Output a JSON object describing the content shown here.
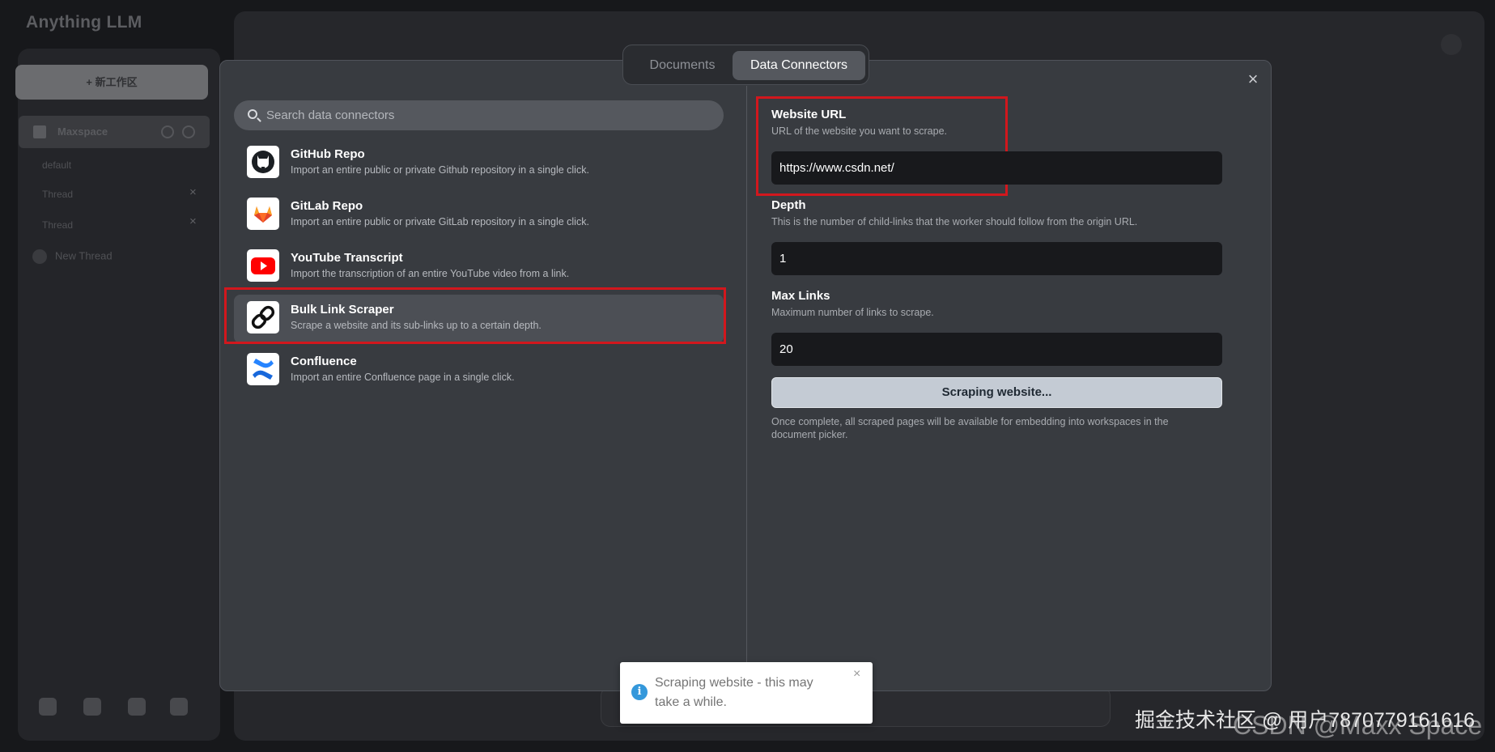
{
  "app": {
    "logo_text": "Anything LLM",
    "new_workspace_label": "+ 新工作区",
    "workspace_name": "Maxspace",
    "threads": [
      "default",
      "Thread",
      "Thread"
    ],
    "new_thread_label": "New Thread"
  },
  "modal": {
    "tabs": [
      {
        "label": "Documents",
        "active": false
      },
      {
        "label": "Data Connectors",
        "active": true
      }
    ],
    "close_symbol": "×",
    "search": {
      "placeholder": "Search data connectors",
      "icon": "search-icon"
    },
    "connectors": [
      {
        "title": "GitHub Repo",
        "description": "Import an entire public or private Github repository in a single click.",
        "icon": "github-icon"
      },
      {
        "title": "GitLab Repo",
        "description": "Import an entire public or private GitLab repository in a single click.",
        "icon": "gitlab-icon"
      },
      {
        "title": "YouTube Transcript",
        "description": "Import the transcription of an entire YouTube video from a link.",
        "icon": "youtube-icon"
      },
      {
        "title": "Bulk Link Scraper",
        "description": "Scrape a website and its sub-links up to a certain depth.",
        "icon": "link-icon",
        "active": true
      },
      {
        "title": "Confluence",
        "description": "Import an entire Confluence page in a single click.",
        "icon": "confluence-icon"
      }
    ],
    "form": {
      "website_url": {
        "label": "Website URL",
        "help": "URL of the website you want to scrape.",
        "value": "https://www.csdn.net/"
      },
      "depth": {
        "label": "Depth",
        "help": "This is the number of child-links that the worker should follow from the origin URL.",
        "value": "1"
      },
      "max_links": {
        "label": "Max Links",
        "help": "Maximum number of links to scrape.",
        "value": "20"
      },
      "submit_label": "Scraping website...",
      "note": "Once complete, all scraped pages will be available for embedding into workspaces in the document picker."
    }
  },
  "toast": {
    "message": "Scraping website - this may take a while.",
    "icon": "info-icon",
    "close_symbol": "×"
  },
  "watermark": {
    "text": "掘金技术社区 @ 用户7870779161616",
    "text2": "CSDN @Maxx Space"
  },
  "colors": {
    "highlight": "#d2171d",
    "modal_bg": "#383b40",
    "field_bg": "#18191c",
    "button_bg": "#c4cbd4",
    "toast_info": "#3498db"
  }
}
